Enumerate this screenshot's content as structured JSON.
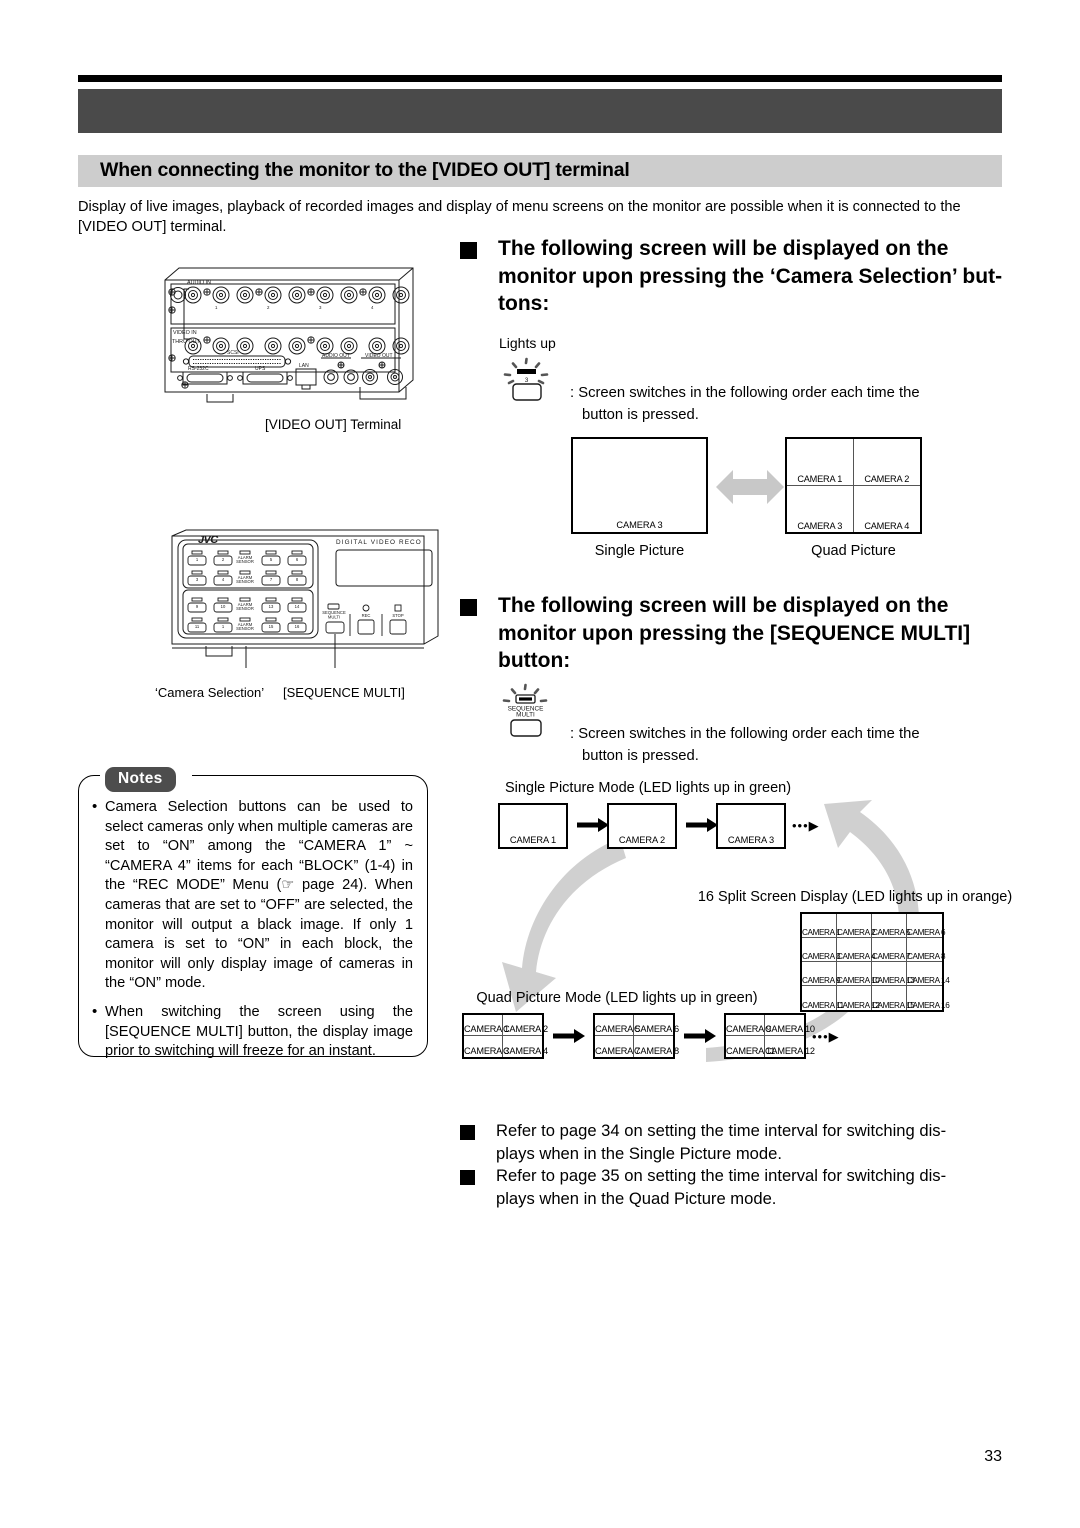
{
  "section": {
    "title": "When connecting the monitor to the [VIDEO OUT] terminal",
    "intro_line1": "Display of live images, playback of recorded images and display of menu screens on the monitor are possible when it is connected",
    "intro_line2": "to the [VIDEO OUT] terminal."
  },
  "heading_camera_selection": {
    "line1": "The following screen will be displayed on the",
    "line2": "monitor upon pressing the ‘Camera Selection’ but-",
    "line3": "tons:"
  },
  "heading_sequence_multi": {
    "line1": "The following screen will be displayed on the",
    "line2": "monitor upon pressing the [SEQUENCE MULTI]",
    "line3": "button:"
  },
  "lights_up_label": "Lights up",
  "button_led_number": "3",
  "sequence_button_label_line1": "SEQUENCE",
  "sequence_button_label_line2": "MULTI",
  "switch_note_1": {
    "line1": ": Screen switches in the following order each time the",
    "line2": "button is pressed."
  },
  "switch_note_2": {
    "line1": ": Screen switches in the following order each time the",
    "line2": "button is pressed."
  },
  "rear_panel": {
    "caption": "[VIDEO OUT] Terminal",
    "labels": {
      "audio_in": "AUDIO IN",
      "video_in": "VIDEO IN",
      "thru_out": "THRU OUT",
      "scsi": "SCSI",
      "rs232c": "RS-232C",
      "ups": "UPS",
      "lan": "LAN",
      "audio_out": "AUDIO OUT",
      "video_out": "VIDEO OUT",
      "ch1": "1",
      "ch2": "2"
    }
  },
  "front_panel": {
    "brand": "JVC",
    "model_text": "DIGITAL  VIDEO  RECO",
    "caption_camera_selection": "‘Camera Selection’",
    "caption_sequence_multi": "[SEQUENCE MULTI]",
    "alarm_sensor": "ALARM\nSENSOR",
    "alarm_sensor_line1": "ALARM",
    "alarm_sensor_line2": "SENSOR",
    "seq_line1": "SEQUENCE",
    "seq_line2": "MULTI",
    "rec_label": "REC",
    "stop_label": "STOP",
    "camera_buttons": [
      "1",
      "2",
      "5",
      "6",
      "3",
      "4",
      "7",
      "8",
      "9",
      "10",
      "13",
      "14",
      "11",
      "1",
      "15",
      "16"
    ]
  },
  "notes": {
    "badge": "Notes",
    "items": [
      "Camera Selection buttons can be used to select cameras only when multiple cameras are set to “ON” among the “CAMERA 1” ~ “CAMERA 4” items for each “BLOCK” (1-4) in the “REC MODE” Menu (☞ page 24). When cameras that are set to “OFF” are selected, the monitor will output a black image. If only 1 camera is set to “ON” in each block, the monitor will only display image of cameras in the “ON” mode.",
      "When switching the screen using the [SEQUENCE MULTI] button, the display image prior to switching will freeze for an instant."
    ]
  },
  "single_quad_diagram": {
    "single_label": "Single Picture",
    "quad_label": "Quad Picture",
    "single_camera": "CAMERA 3",
    "quad_cameras": [
      "CAMERA 1",
      "CAMERA 2",
      "CAMERA 3",
      "CAMERA 4"
    ]
  },
  "cycle_diagram": {
    "single_mode_caption": "Single Picture Mode (LED lights up in green)",
    "single_screens": [
      "CAMERA 1",
      "CAMERA 2",
      "CAMERA 3"
    ],
    "single_ellipsis": "•••▶",
    "quad_mode_caption": "Quad Picture Mode (LED lights up in green)",
    "quad_screens": [
      [
        "CAMERA 1",
        "CAMERA 2",
        "CAMERA 3",
        "CAMERA 4"
      ],
      [
        "CAMERA 5",
        "CAMERA 6",
        "CAMERA 7",
        "CAMERA 8"
      ],
      [
        "CAMERA 9",
        "CAMERA 10",
        "CAMERA 11",
        "CAMERA 12"
      ]
    ],
    "quad_ellipsis": "•••▶",
    "split16_caption": "16 Split Screen Display (LED lights up in orange)",
    "split16_cameras": [
      "CAMERA 1",
      "CAMERA 2",
      "CAMERA 5",
      "CAMERA 6",
      "CAMERA 3",
      "CAMERA 4",
      "CAMERA 7",
      "CAMERA 8",
      "CAMERA 9",
      "CAMERA 10",
      "CAMERA 13",
      "CAMERA 14",
      "CAMERA 11",
      "CAMERA 12",
      "CAMERA 15",
      "CAMERA 16"
    ]
  },
  "refer_items": [
    {
      "line1": "Refer to page 34 on setting the time interval for switching dis-",
      "line2": "plays when in the Single Picture mode."
    },
    {
      "line1": "Refer to page 35 on setting the time interval for switching dis-",
      "line2": "plays when in the Quad Picture mode."
    }
  ],
  "page_number": "33",
  "colors": {
    "header_band": "#4a4a4a",
    "title_band": "#cdcdcd",
    "arrow_gray": "#c8c8c8",
    "notes_badge": "#4d4d4d"
  }
}
